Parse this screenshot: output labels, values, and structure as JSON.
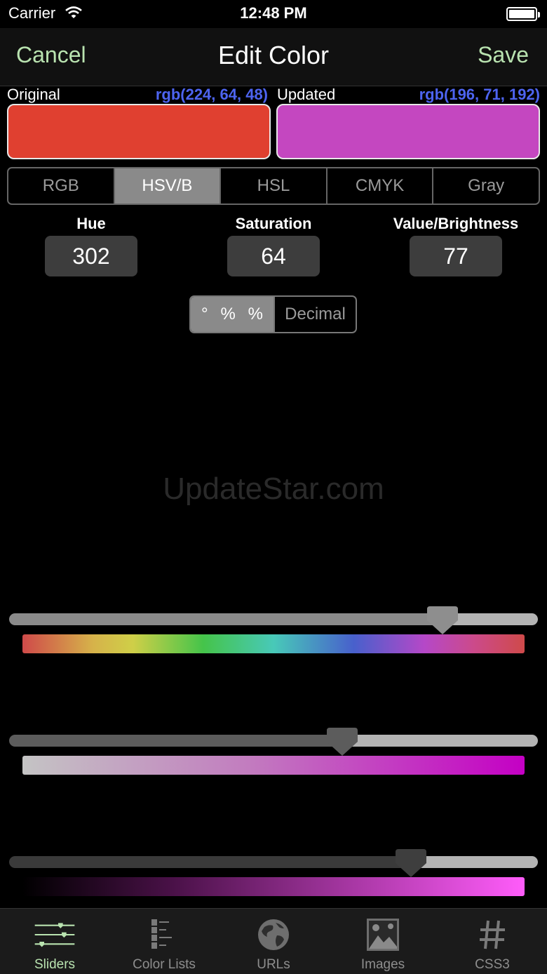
{
  "status_bar": {
    "carrier": "Carrier",
    "time": "12:48 PM"
  },
  "nav": {
    "cancel_label": "Cancel",
    "title": "Edit Color",
    "save_label": "Save"
  },
  "original": {
    "label": "Original",
    "rgb_text": "rgb(224, 64, 48)",
    "color": "#e04030"
  },
  "updated": {
    "label": "Updated",
    "rgb_text": "rgb(196, 71, 192)",
    "color": "#c447c0"
  },
  "models": {
    "items": [
      "RGB",
      "HSV/B",
      "HSL",
      "CMYK",
      "Gray"
    ],
    "selected": "HSV/B"
  },
  "components": [
    {
      "label": "Hue",
      "value": "302"
    },
    {
      "label": "Saturation",
      "value": "64"
    },
    {
      "label": "Value/Brightness",
      "value": "77"
    }
  ],
  "units": {
    "symbols": [
      "°",
      "%",
      "%"
    ],
    "alt_label": "Decimal"
  },
  "watermark": "UpdateStar.com",
  "sliders": [
    {
      "name": "hue",
      "level": 0.82
    },
    {
      "name": "saturation",
      "level": 0.63
    },
    {
      "name": "value",
      "level": 0.76
    }
  ],
  "tabs": [
    "Sliders",
    "Color Lists",
    "URLs",
    "Images",
    "CSS3"
  ],
  "active_tab": "Sliders",
  "colors": {
    "accent": "#b9e3b0",
    "rgb_text": "#4d64f0",
    "segment_selected": "#8a8a8a"
  },
  "icons": [
    "wifi-icon",
    "battery-icon",
    "sliders-icon",
    "color-lists-icon",
    "globe-icon",
    "image-icon",
    "hash-icon"
  ]
}
